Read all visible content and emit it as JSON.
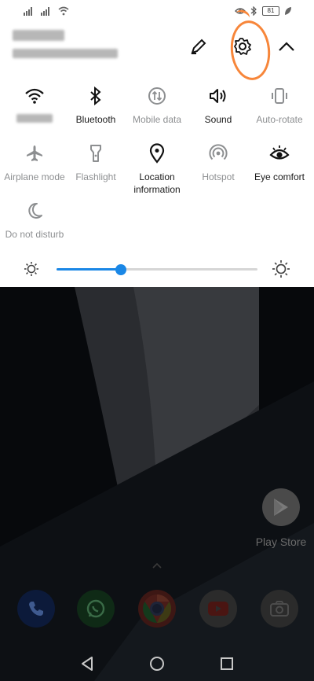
{
  "status_bar": {
    "battery_level": "81",
    "icons": [
      "signal-icon",
      "signal-icon",
      "wifi-icon",
      "eye-icon",
      "bluetooth-icon",
      "battery-icon",
      "leaf-icon"
    ]
  },
  "quick_settings": {
    "tiles": [
      {
        "label": "",
        "icon": "wifi-icon",
        "active": true
      },
      {
        "label": "Bluetooth",
        "icon": "bluetooth-icon",
        "active": true
      },
      {
        "label": "Mobile data",
        "icon": "mobile-data-icon",
        "active": false
      },
      {
        "label": "Sound",
        "icon": "sound-icon",
        "active": true
      },
      {
        "label": "Auto-rotate",
        "icon": "auto-rotate-icon",
        "active": false
      },
      {
        "label": "Airplane mode",
        "icon": "airplane-icon",
        "active": false
      },
      {
        "label": "Flashlight",
        "icon": "flashlight-icon",
        "active": false
      },
      {
        "label": "Location information",
        "icon": "location-icon",
        "active": true
      },
      {
        "label": "Hotspot",
        "icon": "hotspot-icon",
        "active": false
      },
      {
        "label": "Eye comfort",
        "icon": "eye-icon",
        "active": true
      },
      {
        "label": "Do not disturb",
        "icon": "moon-icon",
        "active": false
      }
    ],
    "brightness": 0.32,
    "accent_color": "#1a87e6",
    "annotation_color": "#f7863a"
  },
  "home": {
    "play_store_label": "Play Store",
    "dock_apps": [
      "phone-icon",
      "whatsapp-icon",
      "chrome-icon",
      "youtube-icon",
      "camera-icon"
    ]
  }
}
